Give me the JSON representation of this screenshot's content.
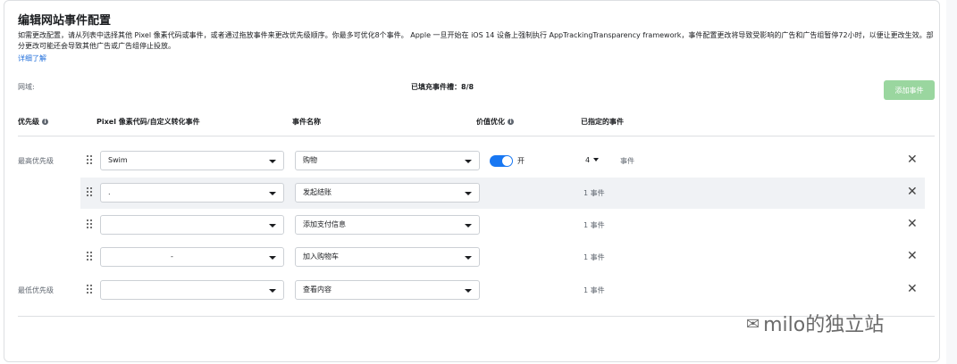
{
  "title": "编辑网站事件配置",
  "description": "如需更改配置，请从列表中选择其他 Pixel 像素代码或事件，或者通过拖放事件来更改优先级顺序。你最多可优化8个事件。 Apple 一旦开始在 iOS 14 设备上强制执行 AppTrackingTransparency framework，事件配置更改将导致受影响的广告和广告组暂停72小时，以便让更改生效。部分更改可能还会导致其他广告或广告组停止投放。",
  "learn_more": "详细了解",
  "domain_label": "网域:",
  "slots_text": "已填充事件槽：8/8",
  "add_event_button": "添加事件",
  "columns": {
    "priority": "优先级",
    "pixel": "Pixel 像素代码/自定义转化事件",
    "event_name": "事件名称",
    "value_optimization": "价值优化",
    "assigned_events": "已指定的事件"
  },
  "rows": [
    {
      "priority": "最高优先级",
      "pixel": "Swim",
      "event": "购物",
      "toggle_label": "开",
      "count": "4",
      "count_unit": "事件"
    },
    {
      "priority": "",
      "pixel": ".",
      "event": "发起结账",
      "assigned": "1 事件"
    },
    {
      "priority": "",
      "pixel": "",
      "event": "添加支付信息",
      "assigned": "1 事件"
    },
    {
      "priority": "",
      "pixel": "-",
      "event": "加入购物车",
      "assigned": "1 事件"
    },
    {
      "priority": "最低优先级",
      "pixel": "",
      "event": "查看内容",
      "assigned": "1 事件"
    }
  ],
  "close_symbol": "✕",
  "watermark": "milo的独立站",
  "colors": {
    "accent": "#1877f2",
    "add_button": "#9ad69f",
    "highlight_row": "#f0f2f5"
  }
}
